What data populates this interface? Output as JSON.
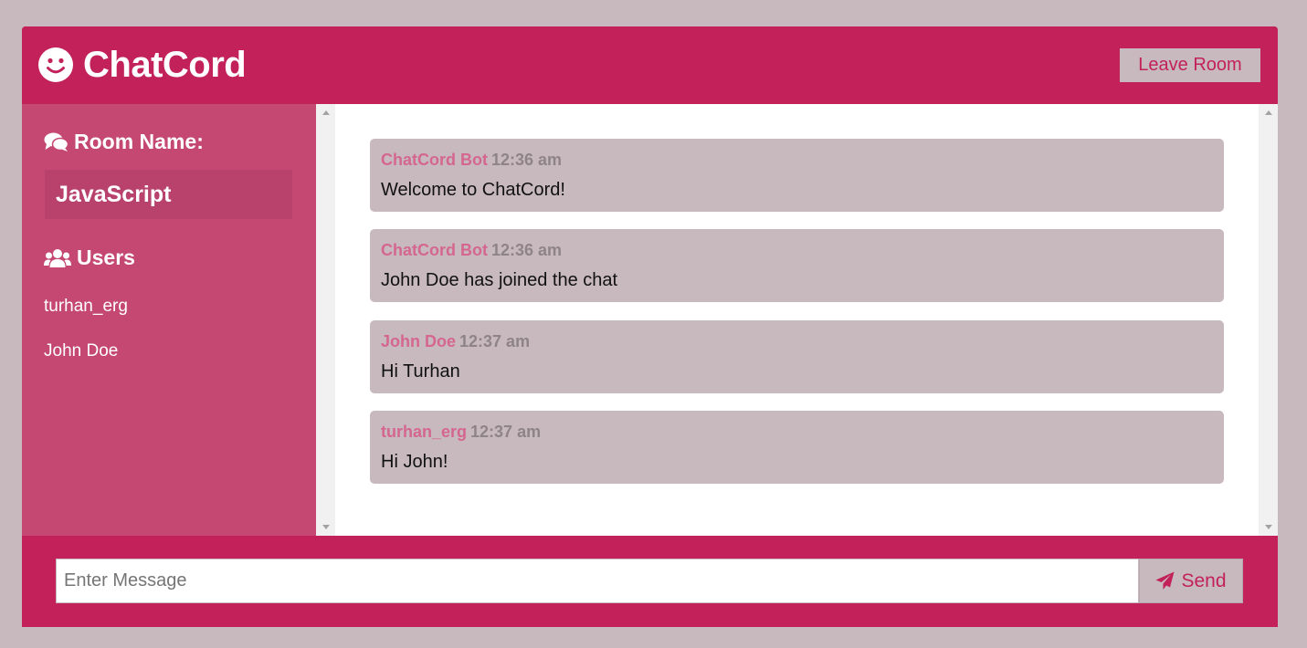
{
  "app": {
    "title": "ChatCord",
    "logo_icon": "smile-icon"
  },
  "header": {
    "leave_label": "Leave Room"
  },
  "sidebar": {
    "room_heading": "Room Name:",
    "room_heading_icon": "comments-icon",
    "room_name": "JavaScript",
    "users_heading": "Users",
    "users_heading_icon": "users-icon",
    "users": [
      "turhan_erg",
      "John Doe"
    ]
  },
  "messages": [
    {
      "author": "ChatCord Bot",
      "time": "12:36 am",
      "text": "Welcome to ChatCord!"
    },
    {
      "author": "ChatCord Bot",
      "time": "12:36 am",
      "text": "John Doe has joined the chat"
    },
    {
      "author": "John Doe",
      "time": "12:37 am",
      "text": "Hi Turhan"
    },
    {
      "author": "turhan_erg",
      "time": "12:37 am",
      "text": "Hi John!"
    }
  ],
  "composer": {
    "placeholder": "Enter Message",
    "value": "",
    "send_label": "Send",
    "send_icon": "paper-plane-icon"
  },
  "colors": {
    "brand": "#c2215a",
    "sidebar": "#c44872",
    "bubble": "#c8b9be",
    "author": "#d4668f",
    "background": "#c8b9be"
  }
}
